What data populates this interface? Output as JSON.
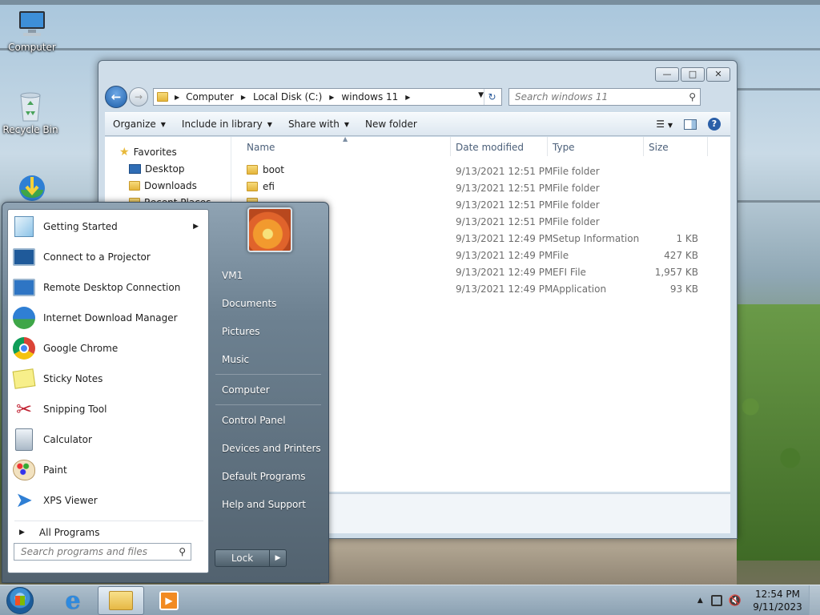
{
  "desktop": {
    "icons": [
      {
        "label": "Computer"
      },
      {
        "label": "Recycle Bin"
      }
    ]
  },
  "explorer": {
    "title_controls": {
      "minimize": "—",
      "maximize": "□",
      "close": "✕"
    },
    "breadcrumb": [
      "Computer",
      "Local Disk (C:)",
      "windows 11"
    ],
    "search_placeholder": "Search windows 11",
    "commands": {
      "organize": "Organize",
      "include_in_library": "Include in library",
      "share_with": "Share with",
      "new_folder": "New folder"
    },
    "nav_pane": {
      "favorites": "Favorites",
      "items": [
        "Desktop",
        "Downloads",
        "Recent Places"
      ]
    },
    "columns": {
      "name": "Name",
      "date_modified": "Date modified",
      "type": "Type",
      "size": "Size"
    },
    "files": [
      {
        "name": "boot",
        "date": "9/13/2021 12:51 PM",
        "type": "File folder",
        "size": ""
      },
      {
        "name": "efi",
        "date": "9/13/2021 12:51 PM",
        "type": "File folder",
        "size": ""
      },
      {
        "name": "",
        "date": "9/13/2021 12:51 PM",
        "type": "File folder",
        "size": ""
      },
      {
        "name": "",
        "date": "9/13/2021 12:51 PM",
        "type": "File folder",
        "size": ""
      },
      {
        "name": "",
        "date": "9/13/2021 12:49 PM",
        "type": "Setup Information",
        "size": "1 KB"
      },
      {
        "name": "",
        "date": "9/13/2021 12:49 PM",
        "type": "File",
        "size": "427 KB"
      },
      {
        "name": "",
        "date": "9/13/2021 12:49 PM",
        "type": "EFI File",
        "size": "1,957 KB"
      },
      {
        "name": "",
        "date": "9/13/2021 12:49 PM",
        "type": "Application",
        "size": "93 KB"
      }
    ]
  },
  "start_menu": {
    "programs": [
      {
        "label": "Getting Started",
        "icon": "getting-started-icon",
        "has_submenu": true
      },
      {
        "label": "Connect to a Projector",
        "icon": "projector-icon"
      },
      {
        "label": "Remote Desktop Connection",
        "icon": "remote-desktop-icon"
      },
      {
        "label": "Internet Download Manager",
        "icon": "idm-icon"
      },
      {
        "label": "Google Chrome",
        "icon": "chrome-icon"
      },
      {
        "label": "Sticky Notes",
        "icon": "sticky-notes-icon"
      },
      {
        "label": "Snipping Tool",
        "icon": "snipping-tool-icon"
      },
      {
        "label": "Calculator",
        "icon": "calculator-icon"
      },
      {
        "label": "Paint",
        "icon": "paint-icon"
      },
      {
        "label": "XPS Viewer",
        "icon": "xps-viewer-icon"
      }
    ],
    "all_programs": "All Programs",
    "search_placeholder": "Search programs and files",
    "right_items": {
      "user": "VM1",
      "documents": "Documents",
      "pictures": "Pictures",
      "music": "Music",
      "computer": "Computer",
      "control_panel": "Control Panel",
      "devices_printers": "Devices and Printers",
      "default_programs": "Default Programs",
      "help_support": "Help and Support"
    },
    "lock_label": "Lock"
  },
  "taskbar": {
    "time": "12:54 PM",
    "date": "9/11/2023"
  },
  "colors": {
    "accent": "#1c5ea8",
    "taskbar": "#9fb3c3"
  }
}
